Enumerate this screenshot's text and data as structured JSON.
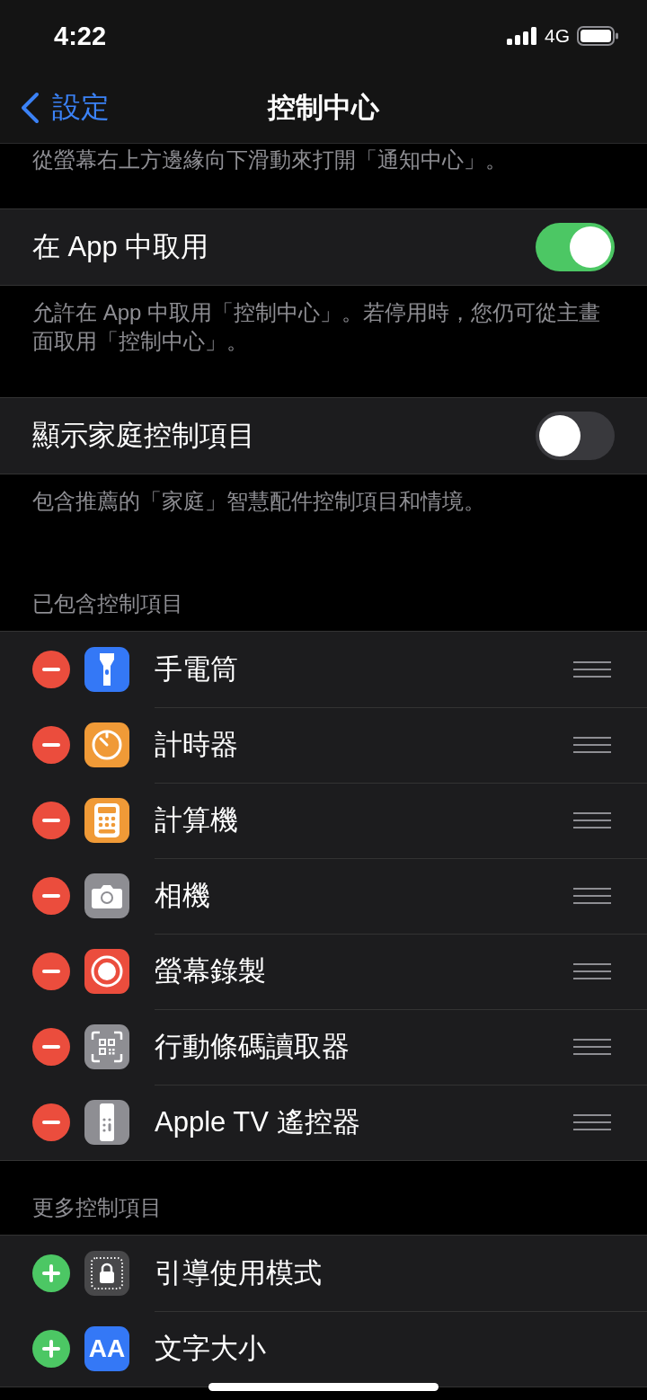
{
  "status_bar": {
    "time": "4:22",
    "network": "4G"
  },
  "nav": {
    "back": "設定",
    "title": "控制中心"
  },
  "top_note": "從螢幕右上方邊緣向下滑動來打開「通知中心」。",
  "settings": [
    {
      "label": "在 App 中取用",
      "on": true,
      "footer": "允許在 App 中取用「控制中心」。若停用時，您仍可從主畫面取用「控制中心」。"
    },
    {
      "label": "顯示家庭控制項目",
      "on": false,
      "footer": "包含推薦的「家庭」智慧配件控制項目和情境。"
    }
  ],
  "sections": [
    {
      "header": "已包含控制項目",
      "kind": "remove",
      "items": [
        {
          "label": "手電筒",
          "kind": "flashlight",
          "color": "#3478f6"
        },
        {
          "label": "計時器",
          "kind": "timer",
          "color": "#f09a37"
        },
        {
          "label": "計算機",
          "kind": "calculator",
          "color": "#f09a37"
        },
        {
          "label": "相機",
          "kind": "camera",
          "color": "#8e8e93"
        },
        {
          "label": "螢幕錄製",
          "kind": "record",
          "color": "#eb4d3d"
        },
        {
          "label": "行動條碼讀取器",
          "kind": "qr",
          "color": "#8e8e93"
        },
        {
          "label": "Apple TV 遙控器",
          "kind": "remote",
          "color": "#8e8e93"
        }
      ]
    },
    {
      "header": "更多控制項目",
      "kind": "add",
      "items": [
        {
          "label": "引導使用模式",
          "kind": "lock",
          "color": "#48484a"
        },
        {
          "label": "文字大小",
          "kind": "textsize",
          "glyph": "AA",
          "color": "#3478f6"
        }
      ]
    }
  ]
}
